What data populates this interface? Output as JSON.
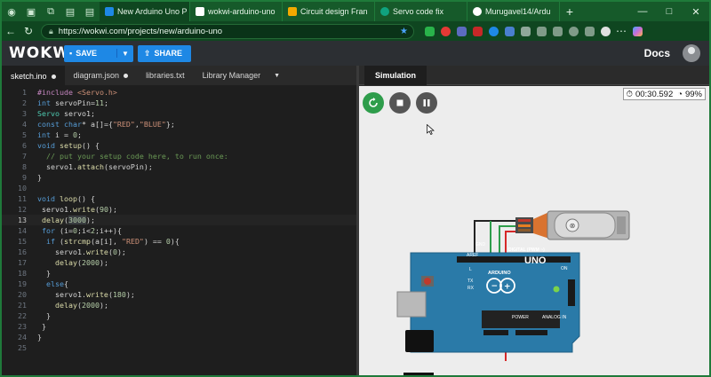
{
  "browser": {
    "tabs": [
      {
        "title": "New Arduino Uno P",
        "favicon_color": "#1e88e5",
        "active": true
      },
      {
        "title": "wokwi-arduino-uno",
        "favicon_color": "#ffffff",
        "active": false
      },
      {
        "title": "Circuit design Fran",
        "favicon_color": "#f2a900",
        "active": false
      },
      {
        "title": "Servo code fix",
        "favicon_color": "#10a37f",
        "active": false
      },
      {
        "title": "Murugavel14/Ardu",
        "favicon_color": "#ffffff",
        "active": false
      }
    ],
    "url": "https://wokwi.com/projects/new/arduino-uno"
  },
  "header": {
    "logo": "WOKWI",
    "save_label": "SAVE",
    "share_label": "SHARE",
    "docs_label": "Docs"
  },
  "editor": {
    "tabs": [
      {
        "label": "sketch.ino",
        "modified": true
      },
      {
        "label": "diagram.json",
        "modified": true
      },
      {
        "label": "libraries.txt",
        "modified": false
      },
      {
        "label": "Library Manager",
        "modified": false
      }
    ],
    "lines": [
      "1",
      "2",
      "3",
      "4",
      "5",
      "6",
      "7",
      "8",
      "9",
      "10",
      "11",
      "12",
      "13",
      "14",
      "15",
      "16",
      "17",
      "18",
      "19",
      "20",
      "21",
      "22",
      "23",
      "24",
      "25"
    ]
  },
  "simulation": {
    "tab_label": "Simulation",
    "elapsed": "00:30.592",
    "speed": "99%"
  },
  "board": {
    "name": "UNO",
    "brand": "ARDUINO",
    "digital_label": "DIGITAL (PWM ~)",
    "on_label": "ON",
    "power_label": "POWER",
    "analog_label": "ANALOG IN",
    "aref": "AREF",
    "gnd": "GND",
    "tx": "TX",
    "rx": "RX",
    "l": "L"
  },
  "colors": {
    "accent": "#1e88e5",
    "run": "#2e9d4b",
    "board": "#2a7aa8"
  }
}
